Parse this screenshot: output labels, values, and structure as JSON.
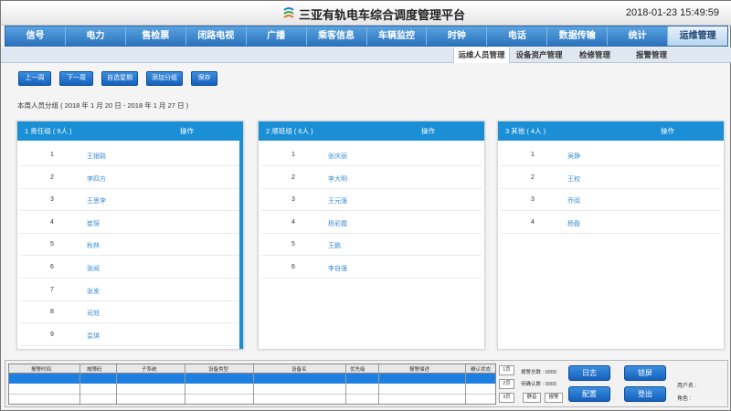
{
  "app": {
    "title": "三亚有轨电车综合调度管理平台",
    "datetime": "2018-01-23 15:49:59"
  },
  "nav": {
    "items": [
      "信号",
      "电力",
      "售检票",
      "闭路电视",
      "广播",
      "乘客信息",
      "车辆监控",
      "时钟",
      "电话",
      "数据传输",
      "统计",
      "运维管理"
    ],
    "active": "运维管理"
  },
  "subnav": {
    "items": [
      "运维人员管理",
      "设备资产管理",
      "检修管理",
      "报警管理"
    ],
    "active": "运维人员管理"
  },
  "toolbar": {
    "prev_week": "上一周",
    "next_week": "下一周",
    "custom_week": "自选星期",
    "add_group": "添加分组",
    "save": "保存"
  },
  "week_info": "本周人员分组 ( 2018 年 1 月 20 日 - 2018 年 1 月 27 日 )",
  "groups": [
    {
      "title": "1 责任组 ( 9人 )",
      "op": "操作",
      "members": [
        {
          "no": "1",
          "name": "王银路"
        },
        {
          "no": "2",
          "name": "李四方"
        },
        {
          "no": "3",
          "name": "王思李"
        },
        {
          "no": "4",
          "name": "崔琛"
        },
        {
          "no": "5",
          "name": "秋林"
        },
        {
          "no": "6",
          "name": "张闻"
        },
        {
          "no": "7",
          "name": "张发"
        },
        {
          "no": "8",
          "name": "司旭"
        },
        {
          "no": "9",
          "name": "袁琪"
        }
      ]
    },
    {
      "title": "2 顺班组 ( 6人 )",
      "op": "操作",
      "members": [
        {
          "no": "1",
          "name": "张庆丽"
        },
        {
          "no": "2",
          "name": "李大明"
        },
        {
          "no": "3",
          "name": "王元强"
        },
        {
          "no": "4",
          "name": "杨彩霞"
        },
        {
          "no": "5",
          "name": "王鹏"
        },
        {
          "no": "6",
          "name": "李自强"
        }
      ]
    },
    {
      "title": "3 其他 ( 4人 )",
      "op": "操作",
      "members": [
        {
          "no": "1",
          "name": "吴静"
        },
        {
          "no": "2",
          "name": "王权"
        },
        {
          "no": "3",
          "name": "乔阅"
        },
        {
          "no": "4",
          "name": "杨磊"
        }
      ]
    }
  ],
  "alarm": {
    "columns": [
      "报警时间",
      "故障码",
      "子系统",
      "设备类型",
      "设备名",
      "优先级",
      "报警描述",
      "确认状态"
    ],
    "btn_1": "1页",
    "btn_2": "2页",
    "btn_3": "3页",
    "total_label": "报警总数 : 0000",
    "unconfirmed_label": "待确认数 : 0000",
    "mute": "静音",
    "alarm_btn": "报警",
    "log": "日志",
    "lock": "锁屏",
    "config": "配置",
    "logout": "登出",
    "user_label": "用户名 :",
    "role_label": "角色 :"
  }
}
